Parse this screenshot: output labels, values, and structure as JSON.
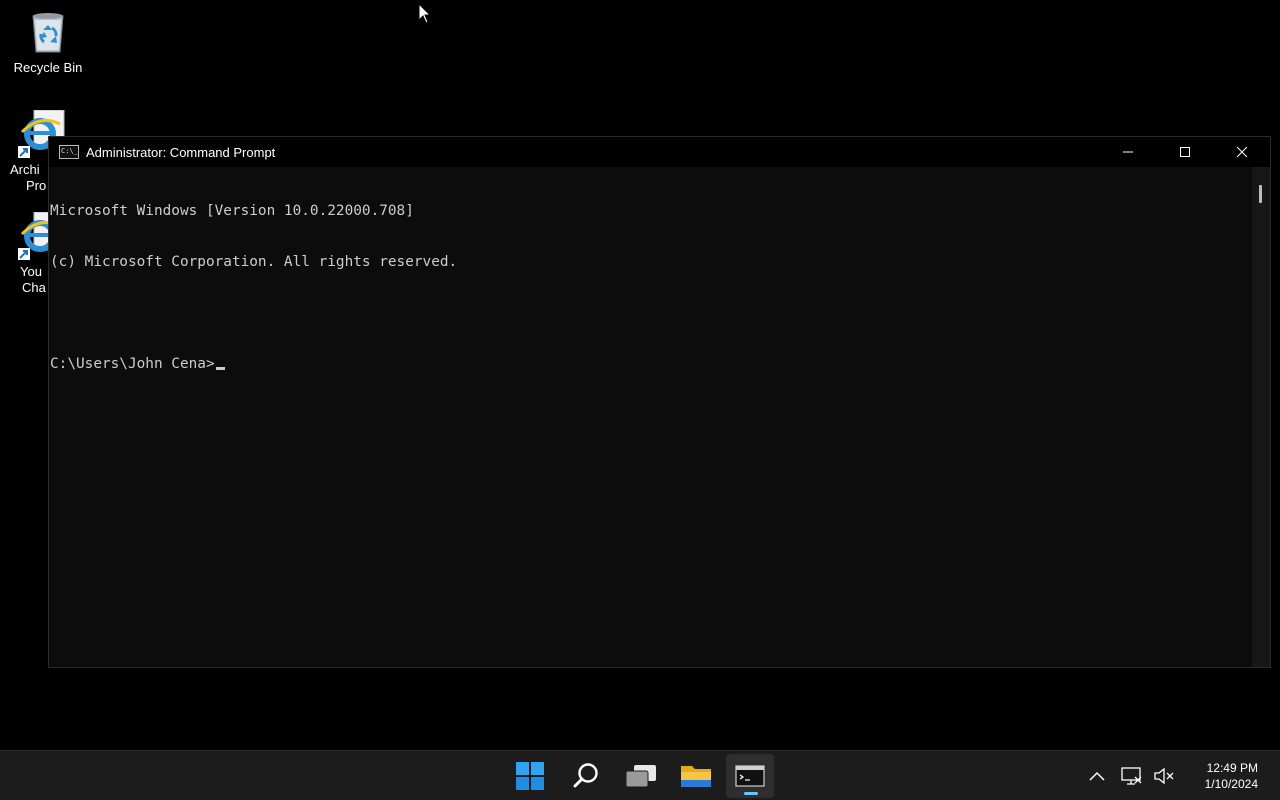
{
  "desktop": {
    "icons": [
      {
        "label": "Recycle Bin"
      },
      {
        "label_line1": "Archi",
        "label_line2": "Pro"
      },
      {
        "label_line1": "You",
        "label_line2": "Cha"
      }
    ]
  },
  "window": {
    "title": "Administrator: Command Prompt",
    "console_lines": [
      "Microsoft Windows [Version 10.0.22000.708]",
      "(c) Microsoft Corporation. All rights reserved.",
      "",
      "C:\\Users\\John Cena>"
    ]
  },
  "taskbar": {
    "apps": [
      "start-icon",
      "search-icon",
      "task-view-icon",
      "file-explorer-icon",
      "command-prompt-icon"
    ],
    "active_app": "command-prompt-icon",
    "tray_icons": [
      "chevron-up-icon",
      "network-icon",
      "volume-muted-icon"
    ],
    "time": "12:49 PM",
    "date": "1/10/2024",
    "accent_color": "#6cc4ff"
  }
}
